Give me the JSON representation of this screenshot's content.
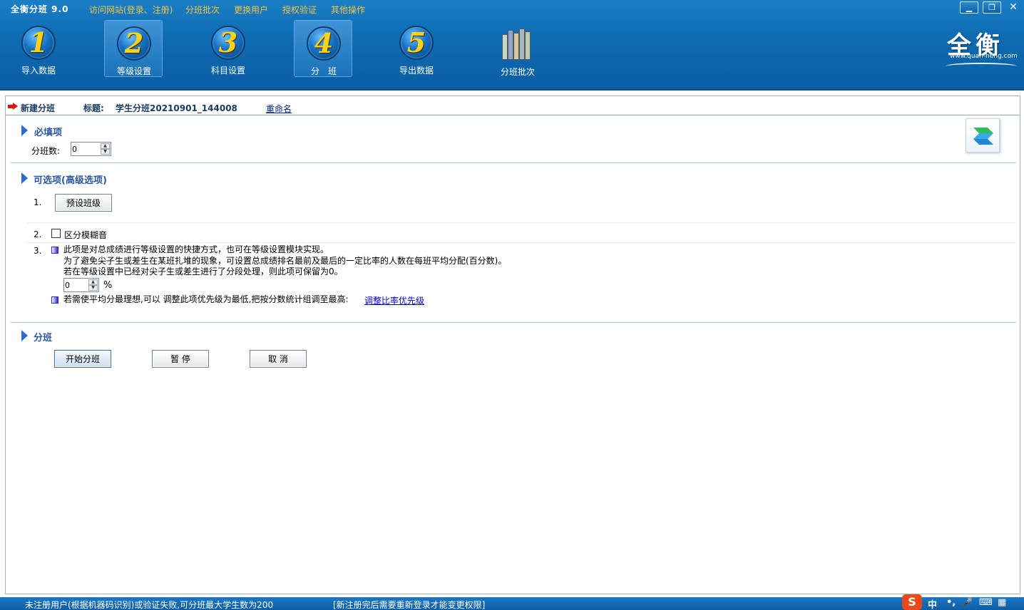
{
  "app": {
    "title": "全衡分班 9.0",
    "menu": [
      "访问网站(登录、注册)",
      "分班批次",
      "更换用户",
      "授权验证",
      "其他操作"
    ],
    "window_controls": {
      "minimize": "▁",
      "restore": "❐",
      "close": "✕"
    }
  },
  "toolbar": {
    "steps": [
      {
        "number": "1",
        "label": "导入数据",
        "active": false
      },
      {
        "number": "2",
        "label": "等级设置",
        "active": true
      },
      {
        "number": "3",
        "label": "科目设置",
        "active": false
      },
      {
        "number": "4",
        "label": "分　班",
        "active": true
      },
      {
        "number": "5",
        "label": "导出数据",
        "active": false
      }
    ],
    "batch": {
      "label": "分班批次",
      "icon": "books-icon"
    },
    "logo": {
      "text": "全衡",
      "url": "www.quan-heng.com"
    }
  },
  "topbar": {
    "new_label": "新建分班",
    "title_label": "标题:",
    "title_value": "学生分班20210901_144008",
    "rename": "重命名"
  },
  "required": {
    "heading": "必填项",
    "class_count_label": "分班数:",
    "class_count_value": "0"
  },
  "optional": {
    "heading": "可选项(高级选项)",
    "item1": {
      "num": "1.",
      "button": "预设班级"
    },
    "item2": {
      "num": "2.",
      "checkbox_label": "区分模糊音",
      "checked": false
    },
    "item3": {
      "num": "3.",
      "line1": "此项是对总成绩进行等级设置的快捷方式，也可在等级设置模块实现。",
      "line2": "为了避免尖子生或差生在某班扎堆的现象，可设置总成绩排名最前及最后的一定比率的人数在每班平均分配(百分数)。",
      "line3": "若在等级设置中已经对尖子生或差生进行了分段处理，则此项可保留为0。",
      "percent_value": "0",
      "percent_unit": "%",
      "note": "若需使平均分最理想,可以 调整此项优先级为最低,把按分数统计组调至最高:",
      "link": "调整比率优先级"
    }
  },
  "divide": {
    "heading": "分班",
    "start": "开始分班",
    "pause": "暂 停",
    "cancel": "取 消"
  },
  "status": {
    "left": "未注册用户(根据机器码识别)或验证失败,可分班最大学生数为200",
    "middle": "[新注册完后需要重新登录才能变更权限]",
    "ime": {
      "logo": "S",
      "lang": "中",
      "punct": "•,",
      "mic": "🎤",
      "keyboard": "⌨",
      "menu": "▦"
    }
  },
  "colors": {
    "header": "#0e6cb3",
    "menu_text": "#f5c542",
    "accent": "#2c58a0",
    "link": "#0000cc"
  }
}
